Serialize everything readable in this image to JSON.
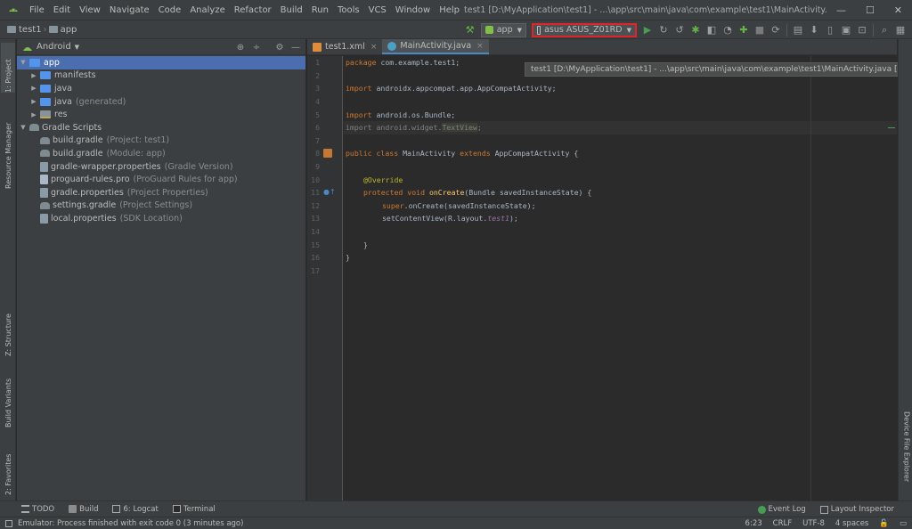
{
  "menubar": {
    "items": [
      "File",
      "Edit",
      "View",
      "Navigate",
      "Code",
      "Analyze",
      "Refactor",
      "Build",
      "Run",
      "Tools",
      "VCS",
      "Window",
      "Help"
    ],
    "window_title": "test1 [D:\\MyApplication\\test1] - ...\\app\\src\\main\\java\\com\\example\\test1\\MainActivity.java [app] - Android Studio",
    "controls": [
      "—",
      "☐",
      "✕"
    ]
  },
  "toolbar": {
    "crumb_project": "test1",
    "crumb_module": "app",
    "run_config": "app",
    "device": "asus ASUS_Z01RD"
  },
  "left_strip": {
    "project": "1: Project",
    "resource_manager": "Resource Manager",
    "structure": "Z: Structure",
    "build_variants": "Build Variants",
    "favorites": "2: Favorites"
  },
  "right_strip": {
    "device_file_explorer": "Device File Explorer"
  },
  "project_panel": {
    "view_mode": "Android",
    "tree": [
      {
        "label": "app",
        "hint": "",
        "level": 0,
        "type": "module",
        "selected": true
      },
      {
        "label": "manifests",
        "hint": "",
        "level": 1,
        "type": "folder"
      },
      {
        "label": "java",
        "hint": "",
        "level": 1,
        "type": "folder"
      },
      {
        "label": "java",
        "hint": "(generated)",
        "level": 1,
        "type": "folder"
      },
      {
        "label": "res",
        "hint": "",
        "level": 1,
        "type": "res"
      },
      {
        "label": "Gradle Scripts",
        "hint": "",
        "level": 0,
        "type": "gradle-root"
      },
      {
        "label": "build.gradle",
        "hint": "(Project: test1)",
        "level": 1,
        "type": "gradle"
      },
      {
        "label": "build.gradle",
        "hint": "(Module: app)",
        "level": 1,
        "type": "gradle"
      },
      {
        "label": "gradle-wrapper.properties",
        "hint": "(Gradle Version)",
        "level": 1,
        "type": "prop"
      },
      {
        "label": "proguard-rules.pro",
        "hint": "(ProGuard Rules for app)",
        "level": 1,
        "type": "file"
      },
      {
        "label": "gradle.properties",
        "hint": "(Project Properties)",
        "level": 1,
        "type": "prop"
      },
      {
        "label": "settings.gradle",
        "hint": "(Project Settings)",
        "level": 1,
        "type": "gradle"
      },
      {
        "label": "local.properties",
        "hint": "(SDK Location)",
        "level": 1,
        "type": "prop"
      }
    ]
  },
  "editor": {
    "tabs": [
      {
        "label": "test1.xml",
        "active": false
      },
      {
        "label": "MainActivity.java",
        "active": true
      }
    ],
    "tooltip": "test1 [D:\\MyApplication\\test1] - ...\\app\\src\\main\\java\\com\\example\\test1\\MainActivity.java [app] - Android Studio",
    "line_numbers": [
      "1",
      "2",
      "3",
      "4",
      "5",
      "6",
      "7",
      "8",
      "9",
      "10",
      "11",
      "12",
      "13",
      "14",
      "15",
      "16",
      "17"
    ]
  },
  "code": {
    "l1": {
      "kw": "package",
      "rest": " com.example.test1;"
    },
    "l3": {
      "kw": "import",
      "rest": " androidx.appcompat.app.AppCompatActivity;"
    },
    "l5": {
      "kw": "import",
      "rest": " android.os.Bundle;"
    },
    "l6": {
      "kw": "import",
      "rest": " android.widget.",
      "cls": "TextView",
      "end": ";"
    },
    "l8": {
      "kw1": "public class",
      "name": " MainActivity ",
      "kw2": "extends",
      "rest": " AppCompatActivity {"
    },
    "l10": {
      "ann": "@Override"
    },
    "l11": {
      "kw": "protected void",
      "fn": " onCreate",
      "rest": "(Bundle savedInstanceState) {"
    },
    "l12": {
      "kw": "super",
      "rest": ".onCreate(savedInstanceState);"
    },
    "l13": {
      "pre": "setContentView(R.layout.",
      "it": "test1",
      "post": ");"
    },
    "l15": {
      "txt": "}"
    },
    "l16": {
      "txt": "}"
    }
  },
  "bottom_bar": {
    "todo": "TODO",
    "build": "Build",
    "logcat": "6: Logcat",
    "terminal": "Terminal",
    "event_log": "Event Log",
    "layout_inspector": "Layout Inspector"
  },
  "status": {
    "message": "Emulator: Process finished with exit code 0 (3 minutes ago)",
    "position": "6:23",
    "line_sep": "CRLF",
    "encoding": "UTF-8",
    "indent": "4 spaces"
  }
}
